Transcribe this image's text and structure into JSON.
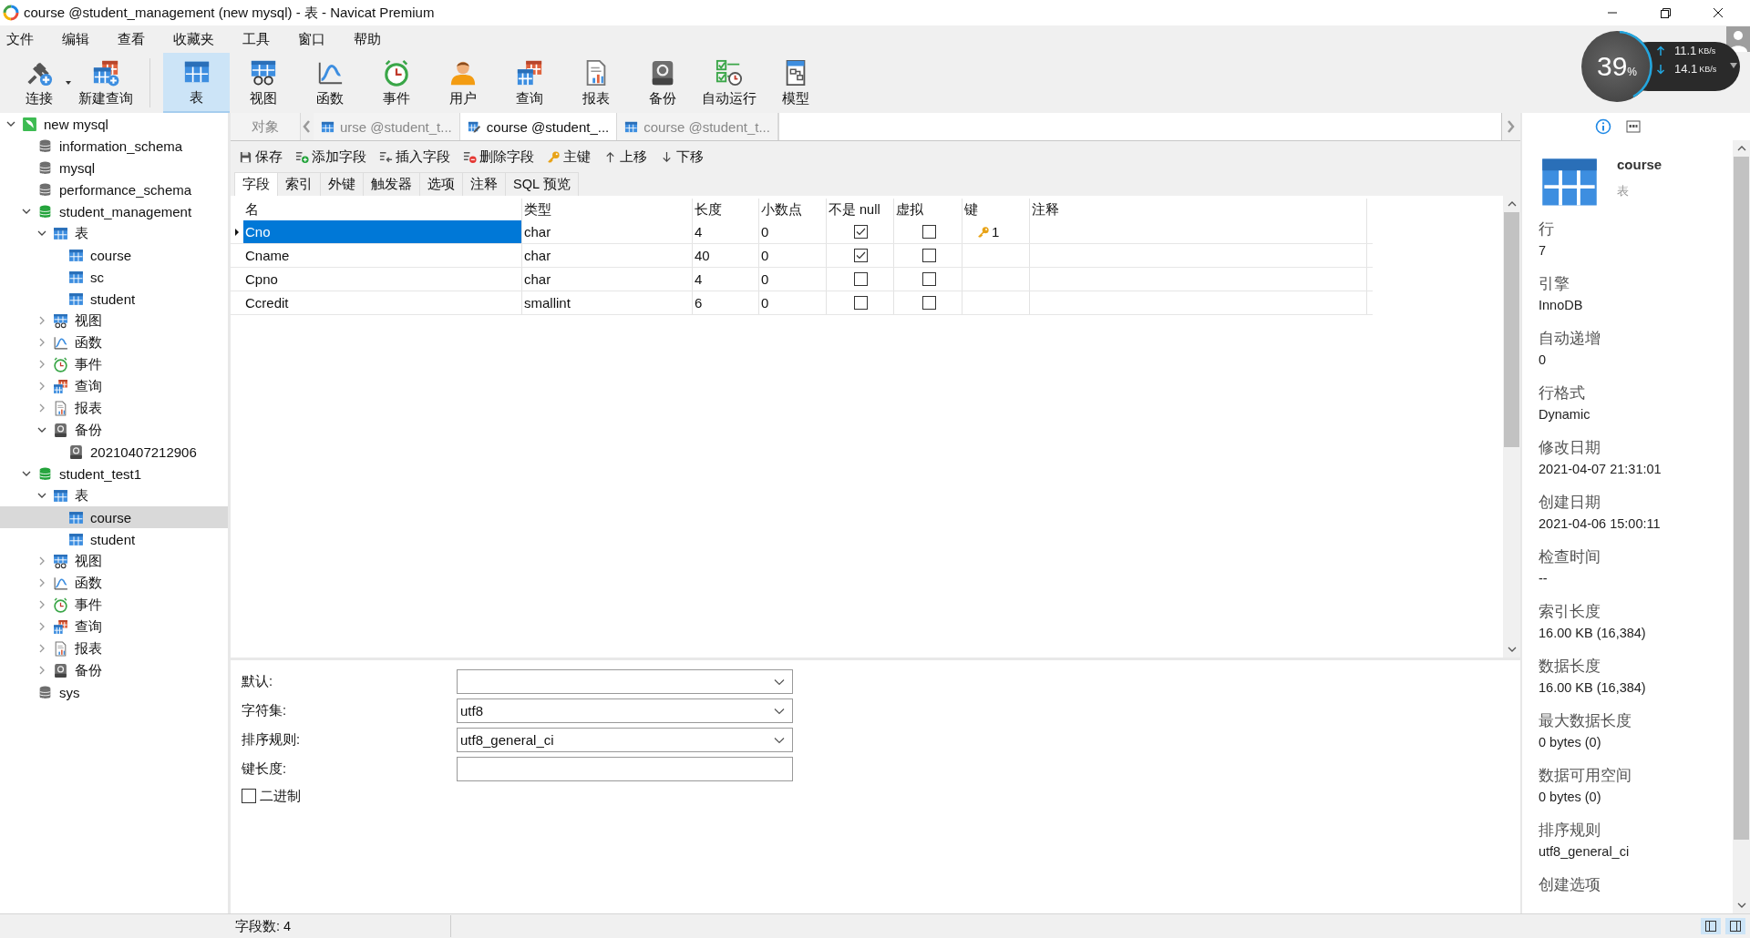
{
  "window": {
    "title": "course @student_management (new mysql) - 表 - Navicat Premium"
  },
  "menu": [
    "文件",
    "编辑",
    "查看",
    "收藏夹",
    "工具",
    "窗口",
    "帮助"
  ],
  "toolbar": [
    {
      "label": "连接",
      "kind": "connect",
      "selected": false,
      "dropdown": true
    },
    {
      "label": "新建查询",
      "kind": "newquery",
      "selected": false,
      "dropdown": false
    },
    {
      "label": "表",
      "kind": "table",
      "selected": true,
      "dropdown": false
    },
    {
      "label": "视图",
      "kind": "view",
      "selected": false,
      "dropdown": false
    },
    {
      "label": "函数",
      "kind": "func",
      "selected": false,
      "dropdown": false
    },
    {
      "label": "事件",
      "kind": "event",
      "selected": false,
      "dropdown": false
    },
    {
      "label": "用户",
      "kind": "user",
      "selected": false,
      "dropdown": false
    },
    {
      "label": "查询",
      "kind": "query",
      "selected": false,
      "dropdown": false
    },
    {
      "label": "报表",
      "kind": "report",
      "selected": false,
      "dropdown": false
    },
    {
      "label": "备份",
      "kind": "backup",
      "selected": false,
      "dropdown": false
    },
    {
      "label": "自动运行",
      "kind": "autorun",
      "selected": false,
      "dropdown": false
    },
    {
      "label": "模型",
      "kind": "model",
      "selected": false,
      "dropdown": false
    }
  ],
  "net_widget": {
    "percent": "39",
    "percent_unit": "%",
    "upload": "11.1",
    "upload_unit": "KB/s",
    "download": "14.1",
    "download_unit": "KB/s"
  },
  "tree": [
    {
      "label": "new mysql",
      "kind": "connection",
      "expanded": true,
      "selected": false,
      "children": [
        {
          "label": "information_schema",
          "kind": "db",
          "selected": false
        },
        {
          "label": "mysql",
          "kind": "db",
          "selected": false
        },
        {
          "label": "performance_schema",
          "kind": "db",
          "selected": false
        },
        {
          "label": "student_management",
          "kind": "db_open",
          "expanded": true,
          "selected": false,
          "children": [
            {
              "label": "表",
              "kind": "table",
              "expanded": true,
              "selected": false,
              "children": [
                {
                  "label": "course",
                  "kind": "table",
                  "selected": false
                },
                {
                  "label": "sc",
                  "kind": "table",
                  "selected": false
                },
                {
                  "label": "student",
                  "kind": "table",
                  "selected": false
                }
              ]
            },
            {
              "label": "视图",
              "kind": "view",
              "expanded": false,
              "selected": false
            },
            {
              "label": "函数",
              "kind": "func",
              "expanded": false,
              "selected": false
            },
            {
              "label": "事件",
              "kind": "event",
              "expanded": false,
              "selected": false
            },
            {
              "label": "查询",
              "kind": "query",
              "expanded": false,
              "selected": false
            },
            {
              "label": "报表",
              "kind": "report",
              "expanded": false,
              "selected": false
            },
            {
              "label": "备份",
              "kind": "backup",
              "expanded": true,
              "selected": false,
              "children": [
                {
                  "label": "20210407212906",
                  "kind": "backup",
                  "selected": false
                }
              ]
            }
          ]
        },
        {
          "label": "student_test1",
          "kind": "db_open",
          "expanded": true,
          "selected": false,
          "children": [
            {
              "label": "表",
              "kind": "table",
              "expanded": true,
              "selected": false,
              "children": [
                {
                  "label": "course",
                  "kind": "table",
                  "selected": true
                },
                {
                  "label": "student",
                  "kind": "table",
                  "selected": false
                }
              ]
            },
            {
              "label": "视图",
              "kind": "view",
              "expanded": false,
              "selected": false
            },
            {
              "label": "函数",
              "kind": "func",
              "expanded": false,
              "selected": false
            },
            {
              "label": "事件",
              "kind": "event",
              "expanded": false,
              "selected": false
            },
            {
              "label": "查询",
              "kind": "query",
              "expanded": false,
              "selected": false
            },
            {
              "label": "报表",
              "kind": "report",
              "expanded": false,
              "selected": false
            },
            {
              "label": "备份",
              "kind": "backup",
              "expanded": false,
              "selected": false
            }
          ]
        },
        {
          "label": "sys",
          "kind": "db",
          "selected": false
        }
      ]
    }
  ],
  "tabs": [
    {
      "label": "对象",
      "kind": "none",
      "selected": false
    },
    {
      "label": "urse @student_t...",
      "kind": "table",
      "selected": false
    },
    {
      "label": "course @student_...",
      "kind": "design",
      "selected": true
    },
    {
      "label": "course @student_t...",
      "kind": "table",
      "selected": false
    }
  ],
  "editor_toolbar": [
    {
      "label": "保存",
      "kind": "save"
    },
    {
      "label": "添加字段",
      "kind": "addfield"
    },
    {
      "label": "插入字段",
      "kind": "insertfield"
    },
    {
      "label": "删除字段",
      "kind": "deletefield"
    },
    {
      "label": "主键",
      "kind": "key"
    },
    {
      "label": "上移",
      "kind": "up"
    },
    {
      "label": "下移",
      "kind": "down"
    }
  ],
  "subtabs": [
    {
      "label": "字段",
      "selected": true
    },
    {
      "label": "索引",
      "selected": false
    },
    {
      "label": "外键",
      "selected": false
    },
    {
      "label": "触发器",
      "selected": false
    },
    {
      "label": "选项",
      "selected": false
    },
    {
      "label": "注释",
      "selected": false
    },
    {
      "label": "SQL 预览",
      "selected": false
    }
  ],
  "fields_table": {
    "columns": [
      "名",
      "类型",
      "长度",
      "小数点",
      "不是 null",
      "虚拟",
      "键",
      "注释"
    ],
    "rows": [
      {
        "name": "Cno",
        "type": "char",
        "length": "4",
        "decimals": "0",
        "not_null": true,
        "virtual": false,
        "key": "1",
        "selected": true
      },
      {
        "name": "Cname",
        "type": "char",
        "length": "40",
        "decimals": "0",
        "not_null": true,
        "virtual": false,
        "selected": false
      },
      {
        "name": "Cpno",
        "type": "char",
        "length": "4",
        "decimals": "0",
        "not_null": false,
        "virtual": false,
        "selected": false
      },
      {
        "name": "Ccredit",
        "type": "smallint",
        "length": "6",
        "decimals": "0",
        "not_null": false,
        "virtual": false,
        "selected": false
      }
    ]
  },
  "properties": [
    {
      "label": "默认:",
      "kind": "dropdown"
    },
    {
      "label": "字符集:",
      "kind": "dropdown",
      "value": "utf8"
    },
    {
      "label": "排序规则:",
      "kind": "dropdown",
      "value": "utf8_general_ci"
    },
    {
      "label": "键长度:",
      "kind": "text"
    }
  ],
  "binary": {
    "label": "二进制",
    "checked": false
  },
  "status_bar": {
    "text": "字段数: 4"
  },
  "info_panel": {
    "name": "course",
    "type": "表",
    "items": [
      {
        "label": "行",
        "value": "7"
      },
      {
        "label": "引擎",
        "value": "InnoDB"
      },
      {
        "label": "自动递增",
        "value": "0"
      },
      {
        "label": "行格式",
        "value": "Dynamic"
      },
      {
        "label": "修改日期",
        "value": "2021-04-07 21:31:01"
      },
      {
        "label": "创建日期",
        "value": "2021-04-06 15:00:11"
      },
      {
        "label": "检查时间",
        "value": "--"
      },
      {
        "label": "索引长度",
        "value": "16.00 KB (16,384)"
      },
      {
        "label": "数据长度",
        "value": "16.00 KB (16,384)"
      },
      {
        "label": "最大数据长度",
        "value": "0 bytes (0)"
      },
      {
        "label": "数据可用空间",
        "value": "0 bytes (0)"
      },
      {
        "label": "排序规则",
        "value": "utf8_general_ci"
      },
      {
        "label": "创建选项"
      }
    ]
  }
}
